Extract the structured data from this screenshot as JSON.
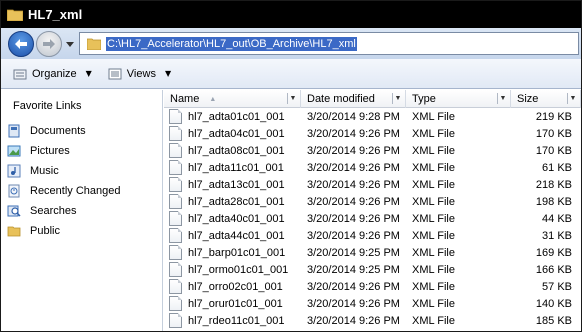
{
  "window": {
    "title": "HL7_xml"
  },
  "address": {
    "path": "C:\\HL7_Accelerator\\HL7_out\\OB_Archive\\HL7_xml"
  },
  "toolbar": {
    "organize_label": "Organize",
    "views_label": "Views"
  },
  "sidebar": {
    "title": "Favorite Links",
    "items": [
      {
        "label": "Documents",
        "icon": "documents-icon"
      },
      {
        "label": "Pictures",
        "icon": "pictures-icon"
      },
      {
        "label": "Music",
        "icon": "music-icon"
      },
      {
        "label": "Recently Changed",
        "icon": "recently-changed-icon"
      },
      {
        "label": "Searches",
        "icon": "searches-icon"
      },
      {
        "label": "Public",
        "icon": "public-folder-icon"
      }
    ]
  },
  "columns": {
    "name": "Name",
    "date": "Date modified",
    "type": "Type",
    "size": "Size"
  },
  "files": [
    {
      "name": "hl7_adta01c01_001",
      "date": "3/20/2014 9:28 PM",
      "type": "XML File",
      "size": "219 KB"
    },
    {
      "name": "hl7_adta04c01_001",
      "date": "3/20/2014 9:26 PM",
      "type": "XML File",
      "size": "170 KB"
    },
    {
      "name": "hl7_adta08c01_001",
      "date": "3/20/2014 9:26 PM",
      "type": "XML File",
      "size": "170 KB"
    },
    {
      "name": "hl7_adta11c01_001",
      "date": "3/20/2014 9:26 PM",
      "type": "XML File",
      "size": "61 KB"
    },
    {
      "name": "hl7_adta13c01_001",
      "date": "3/20/2014 9:26 PM",
      "type": "XML File",
      "size": "218 KB"
    },
    {
      "name": "hl7_adta28c01_001",
      "date": "3/20/2014 9:26 PM",
      "type": "XML File",
      "size": "198 KB"
    },
    {
      "name": "hl7_adta40c01_001",
      "date": "3/20/2014 9:26 PM",
      "type": "XML File",
      "size": "44 KB"
    },
    {
      "name": "hl7_adta44c01_001",
      "date": "3/20/2014 9:26 PM",
      "type": "XML File",
      "size": "31 KB"
    },
    {
      "name": "hl7_barp01c01_001",
      "date": "3/20/2014 9:25 PM",
      "type": "XML File",
      "size": "169 KB"
    },
    {
      "name": "hl7_ormo01c01_001",
      "date": "3/20/2014 9:25 PM",
      "type": "XML File",
      "size": "166 KB"
    },
    {
      "name": "hl7_orro02c01_001",
      "date": "3/20/2014 9:26 PM",
      "type": "XML File",
      "size": "57 KB"
    },
    {
      "name": "hl7_orur01c01_001",
      "date": "3/20/2014 9:26 PM",
      "type": "XML File",
      "size": "140 KB"
    },
    {
      "name": "hl7_rdeo11c01_001",
      "date": "3/20/2014 9:26 PM",
      "type": "XML File",
      "size": "185 KB"
    }
  ]
}
